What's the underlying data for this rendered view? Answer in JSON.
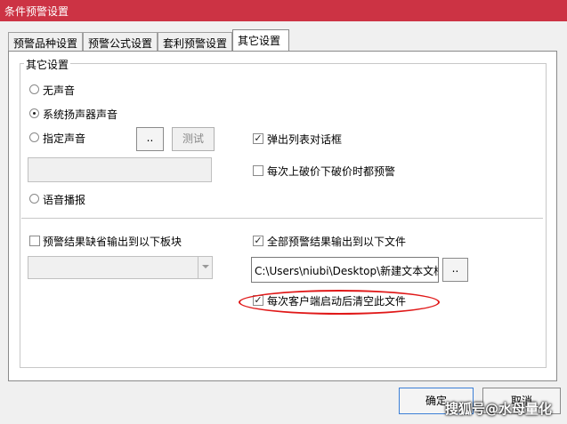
{
  "window": {
    "title": "条件预警设置"
  },
  "tabs": [
    {
      "label": "预警品种设置"
    },
    {
      "label": "预警公式设置"
    },
    {
      "label": "套利预警设置"
    },
    {
      "label": "其它设置",
      "active": true
    }
  ],
  "group": {
    "label": "其它设置"
  },
  "sound": {
    "options": [
      {
        "label": "无声音",
        "selected": false
      },
      {
        "label": "系统扬声器声音",
        "selected": true
      },
      {
        "label": "指定声音",
        "selected": false
      },
      {
        "label": "语音播报",
        "selected": false
      }
    ],
    "browse_label": "..",
    "test_label": "测试",
    "file_value": ""
  },
  "popup": {
    "label": "弹出列表对话框",
    "checked": true
  },
  "every_break": {
    "label": "每次上破价下破价时都预警",
    "checked": false
  },
  "output_block": {
    "label": "预警结果缺省输出到以下板块",
    "checked": false,
    "selected_value": ""
  },
  "output_file": {
    "label": "全部预警结果输出到以下文件",
    "checked": true,
    "path": "C:\\Users\\niubi\\Desktop\\新建文本文档.txt",
    "browse_label": ".."
  },
  "clear_on_start": {
    "label": "每次客户端启动后清空此文件",
    "checked": true
  },
  "footer": {
    "ok_label": "确定",
    "cancel_label": "取消"
  },
  "watermark": {
    "text": "搜狐号@水母量化"
  },
  "colors": {
    "title_bar": "#cc3344",
    "highlight_ellipse": "#e01818"
  }
}
